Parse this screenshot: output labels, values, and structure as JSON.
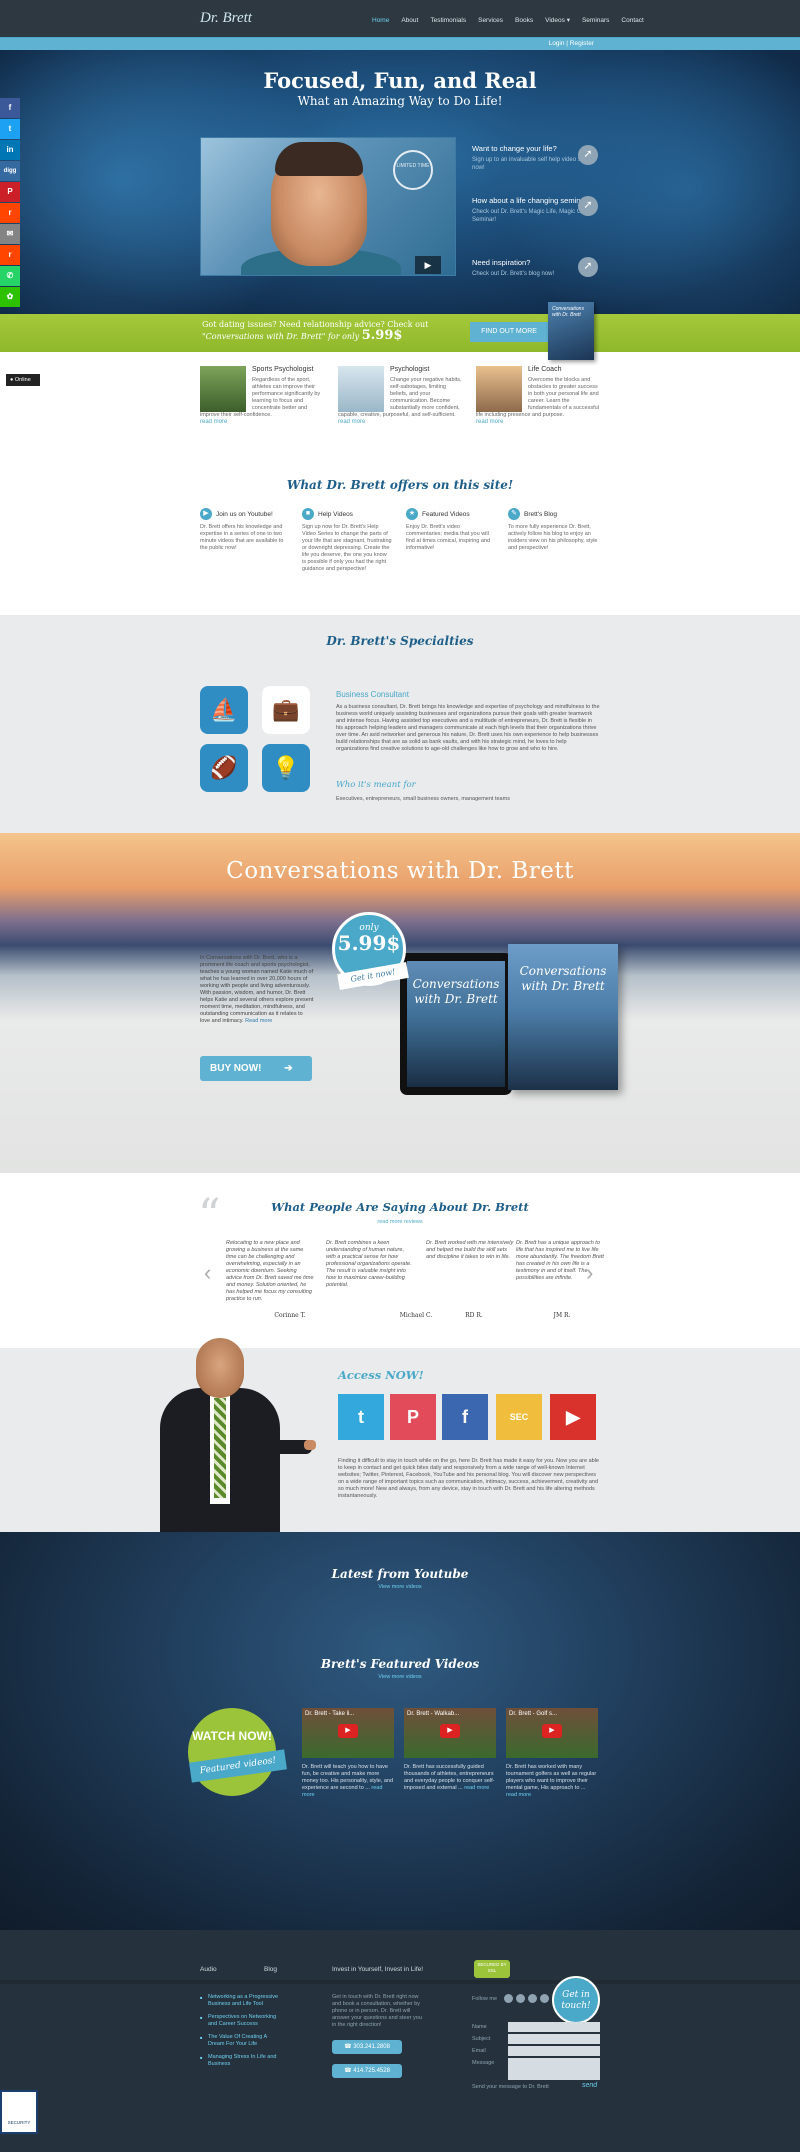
{
  "header": {
    "logo": "Dr. Brett",
    "nav": [
      "Home",
      "About",
      "Testimonials",
      "Services",
      "Books",
      "Videos ▾",
      "Seminars",
      "Contact"
    ],
    "login": "Login | Register"
  },
  "hero": {
    "title": "Focused, Fun, and Real",
    "subtitle": "What an Amazing Way to Do Life!",
    "seal": "LIMITED TIME",
    "ctas": [
      {
        "title": "Want to change your life?",
        "desc": "Sign up to an invaluable self help video series now!"
      },
      {
        "title": "How about a life changing seminar?",
        "desc": "Check out Dr. Brett's Magic Life, Magic Golf Seminar!"
      },
      {
        "title": "Need inspiration?",
        "desc": "Check out Dr. Brett's blog now!"
      }
    ]
  },
  "promo": {
    "line1": "Got dating issues? Need relationship advice? Check out",
    "line2": "\"Conversations with Dr. Brett\" for only",
    "price": "5.99$",
    "button": "FIND OUT MORE",
    "book": "Conversations with Dr. Brett"
  },
  "social": [
    "f",
    "t",
    "in",
    "digg",
    "P",
    "r",
    "✉",
    "r",
    "✆",
    "✿"
  ],
  "online": "Online",
  "services": [
    {
      "title": "Sports Psychologist",
      "desc": "Regardless of the sport, athletes can improve their performance significantly by learning to focus and concentrate better and improve their self-confidence.",
      "more": "read more"
    },
    {
      "title": "Psychologist",
      "desc": "Change your negative habits, self-sabotages, limiting beliefs, and your communication. Become substantially more confident, capable, creative, purposeful, and self-sufficient.",
      "more": "read more"
    },
    {
      "title": "Life Coach",
      "desc": "Overcome the blocks and obstacles to greater success in both your personal life and career. Learn the fundamentals of a successful life including presence and purpose.",
      "more": "read more"
    }
  ],
  "offers": {
    "title": "What Dr. Brett offers on this site!",
    "items": [
      {
        "title": "Join us on Youtube!",
        "desc": "Dr. Brett offers his knowledge and expertise in a series of one to two minute videos that are available to the public now!"
      },
      {
        "title": "Help Videos",
        "desc": "Sign up now for Dr. Brett's Help Video Series to change the parts of your life that are stagnant, frustrating or downright depressing. Create the life you deserve, the one you know is possible if only you had the right guidance and perspective!"
      },
      {
        "title": "Featured Videos",
        "desc": "Enjoy Dr. Brett's video commentaries; media that you will find at times comical, inspiring and informative!"
      },
      {
        "title": "Brett's Blog",
        "desc": "To more fully experience Dr. Brett, actively follow his blog to enjoy an insiders view on his philosophy, style and perspective!"
      }
    ]
  },
  "specialties": {
    "title": "Dr. Brett's Specialties",
    "icons": [
      "⛵",
      "💼",
      "🏈",
      "💡"
    ],
    "heading": "Business Consultant",
    "text": "As a business consultant, Dr. Brett brings his knowledge and expertise of psychology and mindfulness to the business world uniquely assisting businesses and organizations pursue their goals with greater teamwork and intense focus. Having assisted top executives and a multitude of entrepreneurs, Dr. Brett is flexible in his approach helping leaders and managers communicate at each high levels that their organizations thrive over time. An avid networker and generous his nature, Dr. Brett uses his own experience to help businesses build relationships that are as solid as bank vaults, and with his strategic mind, he loves to help organizations find creative solutions to age-old challenges like how to grow and who to hire.",
    "who_title": "Who it's meant for",
    "who_text": "Executives, entrepreneurs, small business owners, management teams"
  },
  "conversations": {
    "title": "Conversations with Dr. Brett",
    "text": "In Conversations with Dr. Brett, who is a prominent life coach and sports psychologist, teaches a young woman named Katie much of what he has learned in over 20,000 hours of working with people and living adventurously. With passion, wisdom, and humor, Dr. Brett helps Katie and several others explore present moment time, meditation, mindfulness, and outstanding communication as it relates to love and intimacy.",
    "more": "Read more",
    "buy": "BUY NOW!",
    "badge_only": "only",
    "badge_price": "5.99$",
    "ribbon": "Get it now!",
    "book_title": "Conversations with Dr. Brett"
  },
  "testimonials": {
    "title": "What People Are Saying About Dr. Brett",
    "more": "read more reviews",
    "items": [
      {
        "text": "Relocating to a new place and growing a business at the same time can be challenging and overwhelming, especially in an economic downturn. Seeking advice from Dr. Brett saved me time and money. Solution oriented, he has helped me focus my consulting practice to run.",
        "name": "Corinne T."
      },
      {
        "text": "Dr. Brett combines a keen understanding of human nature, with a practical sense for how professional organizations operate. The result is valuable insight into how to maximize career-building potential.",
        "name": "Michael C."
      },
      {
        "text": "Dr. Brett worked with me intensively and helped me build the skill sets and discipline it takes to win in life.",
        "name": "RD R."
      },
      {
        "text": "Dr. Brett has a unique approach to life that has inspired me to live life more abundantly. The freedom Brett has created in his own life is a testimony in and of itself. The possibilities are infinite.",
        "name": "JM R."
      }
    ]
  },
  "access": {
    "title": "Access NOW!",
    "buttons": [
      {
        "label": "t",
        "color": "#32a8dc"
      },
      {
        "label": "P",
        "color": "#e14b5a"
      },
      {
        "label": "f",
        "color": "#3b66b0"
      },
      {
        "label": "SEC",
        "color": "#f1bd3c"
      },
      {
        "label": "▶",
        "color": "#d9322d"
      }
    ],
    "text": "Finding it difficult to stay in touch while on the go, here Dr. Brett has made it easy for you. Now you are able to keep in contact and get quick bites daily and responsively from a wide range of well-known Internet websites; Twitter, Pinterest, Facebook, YouTube and his personal blog. You will discover new perspectives on a wide range of important topics such as communication, intimacy, success, achievement, creativity and so much more! New and always, from any device, stay in touch with Dr. Brett and his life altering methods instantaneously."
  },
  "youtube": {
    "title": "Latest from Youtube",
    "more": "View more videos"
  },
  "featured": {
    "title": "Brett's Featured Videos",
    "more": "View more videos",
    "watch": "WATCH NOW!",
    "ribbon": "Featured videos!",
    "videos": [
      {
        "title": "Dr. Brett - Take li...",
        "desc": "Dr. Brett will teach you how to have fun, be creative and make more money too. His personality, style, and experience are second to ...",
        "more": "read more"
      },
      {
        "title": "Dr. Brett - Walkab...",
        "desc": "Dr. Brett has successfully guided thousands of athletes, entrepreneurs and everyday people to conquer self-imposed and external ...",
        "more": "read more"
      },
      {
        "title": "Dr. Brett - Golf s...",
        "desc": "Dr. Brett has worked with many tournament golfers as well as regular players who want to improve their mental game, His approach to ...",
        "more": "read more"
      }
    ]
  },
  "footer": {
    "col1": "Audio",
    "col2": "Blog",
    "links": [
      "Networking as a Progressive Business and Life Tool",
      "Perspectives on Networking and Career Success",
      "The Value Of Creating A Dream For Your Life",
      "Managing Stress In Life and Business"
    ],
    "invest": "Invest in Yourself, Invest in Life!",
    "text": "Get in touch with Dr. Brett right now and book a consultation, whether by phone or in person. Dr. Brett will answer your questions and steer you in the right direction!",
    "phone1": "☎ 303.241.2808",
    "phone2": "☎ 414.725.4528",
    "follow": "Follow me",
    "form": [
      "Name",
      "Subject",
      "Email",
      "Message"
    ],
    "note": "Send your message to Dr. Brett",
    "send": "send",
    "git": "Get in touch!",
    "secure": "SECURED BY SSL",
    "trust": "SECURITY"
  }
}
